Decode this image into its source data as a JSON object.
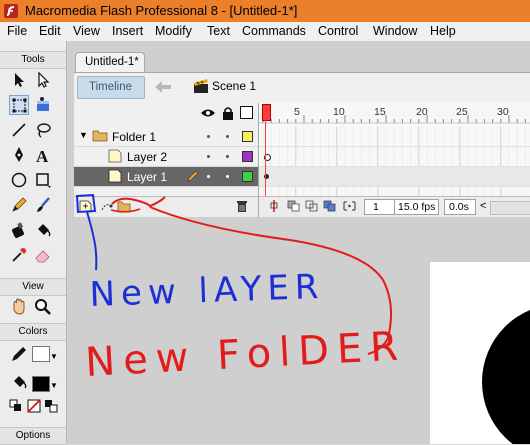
{
  "window": {
    "title": "Macromedia Flash Professional 8 - [Untitled-1*]"
  },
  "menu": [
    "File",
    "Edit",
    "View",
    "Insert",
    "Modify",
    "Text",
    "Commands",
    "Control",
    "Window",
    "Help"
  ],
  "tools_panel": {
    "headers": {
      "tools": "Tools",
      "view": "View",
      "colors": "Colors",
      "options": "Options"
    },
    "tool_icons": [
      "selection-arrow-icon",
      "subselection-arrow-icon",
      "free-transform-icon",
      "gradient-transform-icon",
      "line-tool-icon",
      "lasso-tool-icon",
      "pen-tool-icon",
      "text-tool-icon",
      "oval-tool-icon",
      "rectangle-tool-icon",
      "pencil-tool-icon",
      "brush-tool-icon",
      "ink-bottle-icon",
      "paint-bucket-icon",
      "eyedropper-icon",
      "eraser-icon",
      "hand-tool-icon",
      "zoom-tool-icon"
    ],
    "stroke_color": "#000000",
    "fill_color": "#000000"
  },
  "document": {
    "tab_label": "Untitled-1*",
    "timeline_button": "Timeline",
    "scene_label": "Scene 1"
  },
  "timeline": {
    "ruler_numbers": [
      "5",
      "10",
      "15",
      "20",
      "25",
      "30"
    ],
    "layers": [
      {
        "name": "Folder 1",
        "type": "folder",
        "color": "#f4ef5c",
        "selected": false
      },
      {
        "name": "Layer 2",
        "type": "layer",
        "color": "#9a33c6",
        "selected": false
      },
      {
        "name": "Layer 1",
        "type": "layer",
        "color": "#3fcf3f",
        "selected": true
      }
    ],
    "current_frame": "1",
    "frame_rate": "15.0 fps",
    "elapsed_time": "0.0s"
  },
  "annotations": {
    "new_layer": "New lAYER",
    "new_folder": "New FolDER",
    "new_layer_color": "#1b2fd6",
    "new_folder_color": "#e21c1c"
  }
}
